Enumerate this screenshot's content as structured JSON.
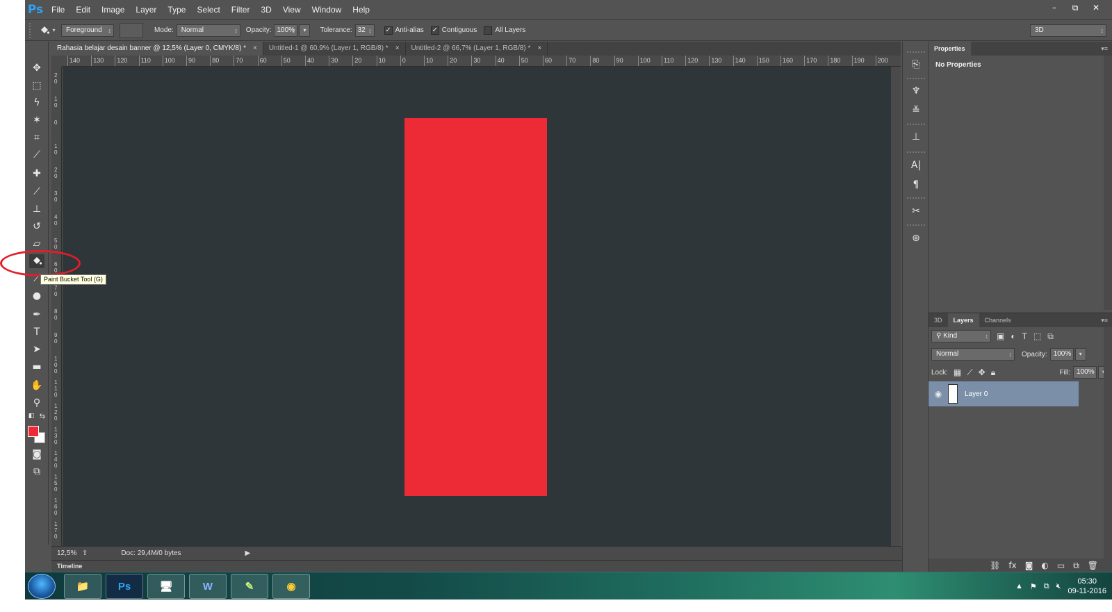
{
  "app": {
    "logo": "Ps",
    "menu": [
      "File",
      "Edit",
      "Image",
      "Layer",
      "Type",
      "Select",
      "Filter",
      "3D",
      "View",
      "Window",
      "Help"
    ],
    "window_controls": [
      "–",
      "⧉",
      "✕"
    ]
  },
  "options": {
    "fill_source": "Foreground",
    "mode_label": "Mode:",
    "mode_value": "Normal",
    "opacity_label": "Opacity:",
    "opacity_value": "100%",
    "tolerance_label": "Tolerance:",
    "tolerance_value": "32",
    "antialias_label": "Anti-alias",
    "antialias_checked": true,
    "contiguous_label": "Contiguous",
    "contiguous_checked": true,
    "all_layers_label": "All Layers",
    "all_layers_checked": false,
    "workspace": "3D"
  },
  "tabs": [
    {
      "label": "Rahasia belajar desain banner  @ 12,5% (Layer 0, CMYK/8) *",
      "close": "×"
    },
    {
      "label": "Untitled-1 @ 60,9% (Layer 1, RGB/8) *",
      "close": "×"
    },
    {
      "label": "Untitled-2 @ 66,7% (Layer 1, RGB/8) *",
      "close": "×"
    }
  ],
  "ruler_top": [
    "140",
    "130",
    "120",
    "110",
    "100",
    "90",
    "80",
    "70",
    "60",
    "50",
    "40",
    "30",
    "20",
    "10",
    "0",
    "10",
    "20",
    "30",
    "40",
    "50",
    "60",
    "70",
    "80",
    "90",
    "100",
    "110",
    "120",
    "130",
    "140",
    "150",
    "160",
    "170",
    "180",
    "190",
    "200"
  ],
  "ruler_left": [
    "2 0",
    "1 0",
    "0",
    "1 0",
    "2 0",
    "3 0",
    "4 0",
    "5 0",
    "6 0",
    "7 0",
    "8 0",
    "9 0",
    "1 0 0",
    "1 1 0",
    "1 2 0",
    "1 3 0",
    "1 4 0",
    "1 5 0",
    "1 6 0",
    "1 7 0"
  ],
  "colors": {
    "foreground": "#ee2a36",
    "background": "#ffffff",
    "canvas_bg": "#2f3639",
    "artboard": "#ec2b36",
    "annotation": "#e31d2a"
  },
  "tooltip": "Paint Bucket Tool (G)",
  "status": {
    "zoom": "12,5%",
    "doc": "Doc: 29,4M/0 bytes",
    "arrow": "▶"
  },
  "timeline": {
    "label": "Timeline",
    "menu": "▾≡"
  },
  "properties": {
    "tab": "Properties",
    "menu": "▾≡",
    "message": "No Properties"
  },
  "layers_panel": {
    "tabs": [
      "3D",
      "Layers",
      "Channels"
    ],
    "menu": "▾≡",
    "kind": "Kind",
    "blend": "Normal",
    "opacity_label": "Opacity:",
    "opacity_value": "100%",
    "lock_label": "Lock:",
    "fill_label": "Fill:",
    "fill_value": "100%",
    "layer_name": "Layer 0"
  },
  "taskbar": {
    "apps": [
      "📁",
      "Ps",
      "🖥",
      "W",
      "✎",
      "◉"
    ],
    "time": "05:30",
    "date": "09-11-2016"
  },
  "icons": {
    "tools": [
      "move-icon",
      "marquee-icon",
      "lasso-icon",
      "magic-wand-icon",
      "crop-icon",
      "eyedropper-icon",
      "healing-icon",
      "brush-icon",
      "stamp-icon",
      "history-brush-icon",
      "eraser-icon",
      "paint-bucket-icon",
      "dodge-icon",
      "pen-icon",
      "type-icon",
      "path-select-icon",
      "rectangle-icon",
      "hand-icon",
      "zoom-icon"
    ]
  }
}
